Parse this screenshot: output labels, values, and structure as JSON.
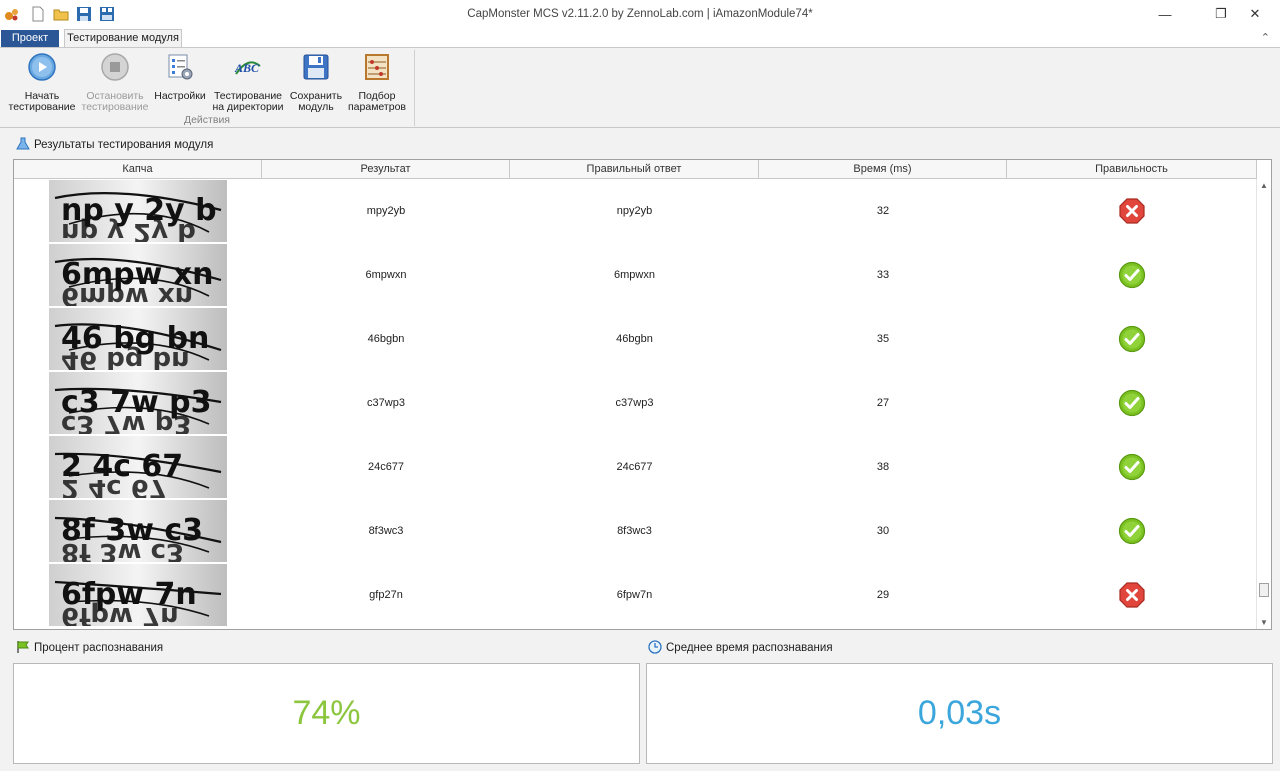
{
  "window": {
    "title": "CapMonster MCS v2.11.2.0 by ZennoLab.com | iAmazonModule74*",
    "controls": [
      "—",
      "❐",
      "✕"
    ]
  },
  "tabs": {
    "project": "Проект",
    "testing": "Тестирование модуля"
  },
  "ribbon": {
    "start": [
      "Начать",
      "тестирование"
    ],
    "stop": [
      "Остановить",
      "тестирование"
    ],
    "settings": [
      "Настройки",
      ""
    ],
    "dir_test": [
      "Тестирование",
      "на директории"
    ],
    "save": [
      "Сохранить",
      "модуль"
    ],
    "params": [
      "Подбор",
      "параметров"
    ],
    "group_label": "Действия"
  },
  "results": {
    "title": "Результаты тестирования модуля",
    "columns": [
      "Капча",
      "Результат",
      "Правильный ответ",
      "Время (ms)",
      "Правильность"
    ],
    "rows": [
      {
        "captcha": "np y 2y b",
        "result": "mpy2yb",
        "answer": "npy2yb",
        "time": "32",
        "correct": false
      },
      {
        "captcha": "6mpw xn",
        "result": "6mpwxn",
        "answer": "6mpwxn",
        "time": "33",
        "correct": true
      },
      {
        "captcha": "46 bg bn",
        "result": "46bgbn",
        "answer": "46bgbn",
        "time": "35",
        "correct": true
      },
      {
        "captcha": "c3 7w p3",
        "result": "c37wp3",
        "answer": "c37wp3",
        "time": "27",
        "correct": true
      },
      {
        "captcha": "2 4c 67",
        "result": "24c677",
        "answer": "24c677",
        "time": "38",
        "correct": true
      },
      {
        "captcha": "8f 3w c3",
        "result": "8f3wc3",
        "answer": "8f3wc3",
        "time": "30",
        "correct": true
      },
      {
        "captcha": "6fpw 7n",
        "result": "gfp27n",
        "answer": "6fpw7n",
        "time": "29",
        "correct": false
      }
    ]
  },
  "stats": {
    "percent_label": "Процент распознавания",
    "percent_value": "74%",
    "time_label": "Среднее время распознавания",
    "time_value": "0,03s"
  },
  "colors": {
    "percent": "#8cc63f",
    "time": "#3aa6dc",
    "ok": "#7cc222",
    "fail": "#e0463c"
  }
}
